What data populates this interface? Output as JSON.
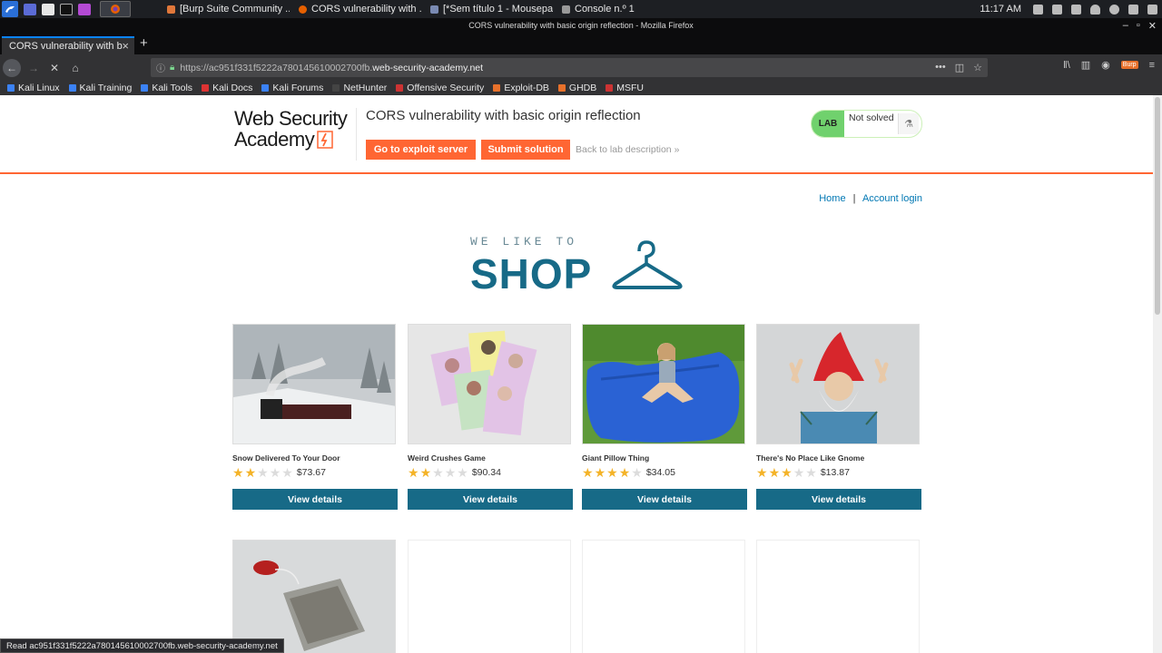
{
  "taskbar": {
    "tasks": [
      {
        "label": "[Burp Suite Community ...",
        "icon": "burp-icon",
        "color": "#e0773a"
      },
      {
        "label": "CORS vulnerability with ...",
        "icon": "firefox-icon",
        "color": "#e66000"
      },
      {
        "label": "[*Sem título 1 - Mousepa...",
        "icon": "mousepad-icon",
        "color": "#7a8ab3"
      },
      {
        "label": "Console n.º 1",
        "icon": "terminal-icon",
        "color": "#999999"
      }
    ],
    "clock": "11:17 AM"
  },
  "window": {
    "title": "CORS vulnerability with basic origin reflection - Mozilla Firefox"
  },
  "browser": {
    "tab_title": "CORS vulnerability with b",
    "url_prefix": "https://ac951f331f5222a780145610002700fb.",
    "url_domain": "web-security-academy.net",
    "burp_badge": "Burp"
  },
  "bookmarks": [
    {
      "label": "Kali Linux",
      "color": "#3b82f6"
    },
    {
      "label": "Kali Training",
      "color": "#3b82f6"
    },
    {
      "label": "Kali Tools",
      "color": "#3b82f6"
    },
    {
      "label": "Kali Docs",
      "color": "#d33"
    },
    {
      "label": "Kali Forums",
      "color": "#3b82f6"
    },
    {
      "label": "NetHunter",
      "color": "#444"
    },
    {
      "label": "Offensive Security",
      "color": "#c33"
    },
    {
      "label": "Exploit-DB",
      "color": "#e8712b"
    },
    {
      "label": "GHDB",
      "color": "#e8712b"
    },
    {
      "label": "MSFU",
      "color": "#c33"
    }
  ],
  "lab": {
    "logo_line1": "Web Security",
    "logo_line2": "Academy",
    "title": "CORS vulnerability with basic origin reflection",
    "exploit_button": "Go to exploit server",
    "submit_button": "Submit solution",
    "back_link": "Back to lab description",
    "back_glyph": "»",
    "status_pill": "LAB",
    "status_text": "Not solved"
  },
  "nav": {
    "home": "Home",
    "separator": "|",
    "account": "Account login"
  },
  "shop": {
    "tagline": "WE LIKE TO",
    "word": "SHOP"
  },
  "products": [
    {
      "name": "Snow Delivered To Your Door",
      "rating": 2,
      "price": "$73.67",
      "button": "View details"
    },
    {
      "name": "Weird Crushes Game",
      "rating": 2,
      "price": "$90.34",
      "button": "View details"
    },
    {
      "name": "Giant Pillow Thing",
      "rating": 4,
      "price": "$34.05",
      "button": "View details"
    },
    {
      "name": "There's No Place Like Gnome",
      "rating": 3,
      "price": "$13.87",
      "button": "View details"
    }
  ],
  "status_bar": "Read ac951f331f5222a780145610002700fb.web-security-academy.net"
}
